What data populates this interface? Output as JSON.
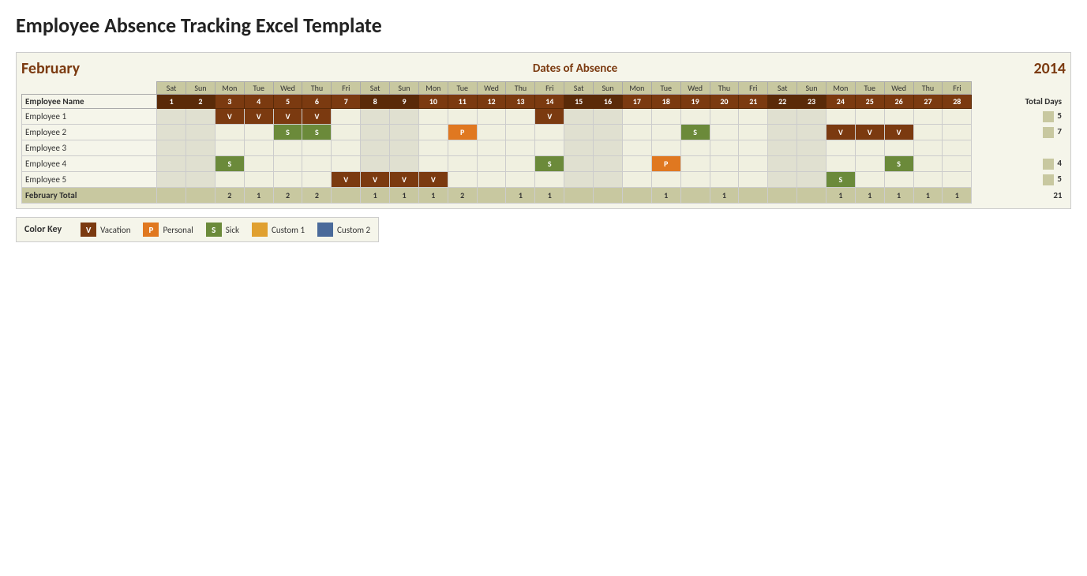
{
  "title": "Employee Absence Tracking Excel Template",
  "month": "February",
  "year": "2014",
  "dates_of_absence": "Dates of Absence",
  "day_headers": [
    {
      "name": "Sat",
      "num": "1",
      "weekend": true
    },
    {
      "name": "Sun",
      "num": "2",
      "weekend": true
    },
    {
      "name": "Mon",
      "num": "3",
      "weekend": false
    },
    {
      "name": "Tue",
      "num": "4",
      "weekend": false
    },
    {
      "name": "Wed",
      "num": "5",
      "weekend": false
    },
    {
      "name": "Thu",
      "num": "6",
      "weekend": false
    },
    {
      "name": "Fri",
      "num": "7",
      "weekend": false
    },
    {
      "name": "Sat",
      "num": "8",
      "weekend": true
    },
    {
      "name": "Sun",
      "num": "9",
      "weekend": true
    },
    {
      "name": "Mon",
      "num": "10",
      "weekend": false
    },
    {
      "name": "Tue",
      "num": "11",
      "weekend": false
    },
    {
      "name": "Wed",
      "num": "12",
      "weekend": false
    },
    {
      "name": "Thu",
      "num": "13",
      "weekend": false
    },
    {
      "name": "Fri",
      "num": "14",
      "weekend": false
    },
    {
      "name": "Sat",
      "num": "15",
      "weekend": true
    },
    {
      "name": "Sun",
      "num": "16",
      "weekend": true
    },
    {
      "name": "Mon",
      "num": "17",
      "weekend": false
    },
    {
      "name": "Tue",
      "num": "18",
      "weekend": false
    },
    {
      "name": "Wed",
      "num": "19",
      "weekend": false
    },
    {
      "name": "Thu",
      "num": "20",
      "weekend": false
    },
    {
      "name": "Fri",
      "num": "21",
      "weekend": false
    },
    {
      "name": "Sat",
      "num": "22",
      "weekend": true
    },
    {
      "name": "Sun",
      "num": "23",
      "weekend": true
    },
    {
      "name": "Mon",
      "num": "24",
      "weekend": false
    },
    {
      "name": "Tue",
      "num": "25",
      "weekend": false
    },
    {
      "name": "Wed",
      "num": "26",
      "weekend": false
    },
    {
      "name": "Thu",
      "num": "27",
      "weekend": false
    },
    {
      "name": "Fri",
      "num": "28",
      "weekend": false
    }
  ],
  "employee_name_header": "Employee Name",
  "total_days_label": "Total Days",
  "employees": [
    {
      "name": "Employee 1",
      "total": "5",
      "absences": {
        "3": "V",
        "4": "V",
        "5": "V",
        "6": "V",
        "14": "V"
      }
    },
    {
      "name": "Employee 2",
      "total": "7",
      "absences": {
        "5": "S",
        "6": "S",
        "11": "P",
        "19": "S",
        "24": "V",
        "25": "V",
        "26": "V"
      }
    },
    {
      "name": "Employee 3",
      "total": "",
      "absences": {}
    },
    {
      "name": "Employee 4",
      "total": "4",
      "absences": {
        "3": "S",
        "14": "S",
        "18": "P",
        "26": "S"
      }
    },
    {
      "name": "Employee 5",
      "total": "5",
      "absences": {
        "7": "V",
        "8": "V",
        "9": "V",
        "10": "V",
        "24": "S"
      }
    }
  ],
  "total_row": {
    "name": "February Total",
    "total": "21",
    "values": {
      "3": "2",
      "4": "1",
      "5": "2",
      "6": "2",
      "8": "1",
      "9": "1",
      "10": "1",
      "11": "2",
      "13": "1",
      "14": "1",
      "18": "1",
      "20": "1",
      "24": "1",
      "25": "1",
      "26": "1",
      "27": "1",
      "28": "1"
    }
  },
  "color_key": {
    "label": "Color Key",
    "items": [
      {
        "badge": "V",
        "label": "Vacation",
        "color": "#7b3a10"
      },
      {
        "badge": "P",
        "label": "Personal",
        "color": "#e07820"
      },
      {
        "badge": "S",
        "label": "Sick",
        "color": "#6b8a3a"
      },
      {
        "badge": "",
        "label": "Custom 1",
        "color": "#e0a030",
        "swatch": true
      },
      {
        "badge": "",
        "label": "Custom 2",
        "color": "#4a6a9a",
        "swatch": true
      }
    ]
  }
}
